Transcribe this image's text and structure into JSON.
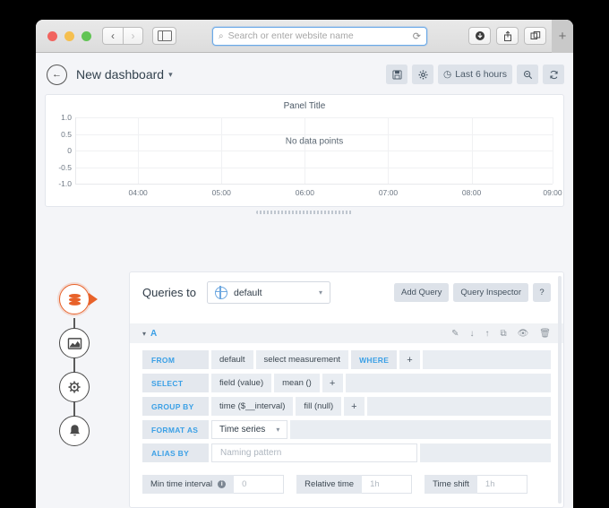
{
  "browser": {
    "traffic_lights": [
      "close",
      "minimize",
      "maximize"
    ],
    "back_label": "‹",
    "forward_label": "›",
    "sidebar_toggle": "sidebar-icon",
    "address_placeholder": "Search or enter website name",
    "search_icon": "⌕",
    "reload_icon": "⟳",
    "download_icon": "⬇",
    "share_icon": "⬆",
    "tabs_icon": "⧉",
    "new_tab_label": "+"
  },
  "dashboard": {
    "back_arrow": "←",
    "title": "New dashboard",
    "title_caret": "▾",
    "toolbar": {
      "save_icon": "⌷",
      "settings_icon": "✸",
      "time_clock_icon": "◷",
      "time_range": "Last 6 hours",
      "zoom_out_icon": "⌕",
      "refresh_icon": "⟳"
    }
  },
  "panel": {
    "title": "Panel Title",
    "no_data_text": "No data points"
  },
  "chart_data": {
    "type": "line",
    "title": "Panel Title",
    "series": [],
    "x": [],
    "xlabel": "",
    "ylabel": "",
    "x_tick_labels": [
      "04:00",
      "05:00",
      "06:00",
      "07:00",
      "08:00",
      "09:00"
    ],
    "y_tick_labels": [
      "1.0",
      "0.5",
      "0",
      "-0.5",
      "-1.0"
    ],
    "y_tick_values": [
      1.0,
      0.5,
      0,
      -0.5,
      -1.0
    ],
    "ylim": [
      -1.0,
      1.0
    ],
    "grid": true,
    "legend": "none",
    "annotation": "No data points"
  },
  "rail": {
    "items": [
      {
        "name": "queries",
        "icon": "⛁",
        "active": true
      },
      {
        "name": "visualization",
        "icon": "📈",
        "active": false
      },
      {
        "name": "general-options",
        "icon": "⚙",
        "active": false
      },
      {
        "name": "alert",
        "icon": "🔔",
        "active": false
      }
    ]
  },
  "editor": {
    "heading": "Queries to",
    "datasource": {
      "name": "default",
      "caret": "▾"
    },
    "add_query_label": "Add Query",
    "query_inspector_label": "Query Inspector",
    "help_label": "?",
    "query": {
      "collapse_caret": "▾",
      "letter": "A",
      "actions": [
        {
          "name": "edit",
          "icon": "✎"
        },
        {
          "name": "move-down",
          "icon": "↓"
        },
        {
          "name": "move-up",
          "icon": "↑"
        },
        {
          "name": "duplicate",
          "icon": "⧉"
        },
        {
          "name": "toggle-visibility",
          "icon": "👁"
        },
        {
          "name": "delete",
          "icon": "🗑"
        }
      ],
      "from_label": "FROM",
      "from_policy": "default",
      "from_measurement": "select measurement",
      "where_label": "WHERE",
      "where_plus": "+",
      "select_label": "SELECT",
      "select_field": "field (value)",
      "select_func": "mean ()",
      "select_plus": "+",
      "group_by_label": "GROUP BY",
      "group_by_time": "time ($__interval)",
      "group_by_fill": "fill (null)",
      "group_by_plus": "+",
      "format_as_label": "FORMAT AS",
      "format_as_value": "Time series",
      "format_as_caret": "▾",
      "alias_by_label": "ALIAS BY",
      "alias_by_placeholder": "Naming pattern"
    },
    "options": {
      "min_time_interval_label": "Min time interval",
      "min_time_interval_info": "i",
      "min_time_interval_value": "0",
      "relative_time_label": "Relative time",
      "relative_time_value": "1h",
      "time_shift_label": "Time shift",
      "time_shift_value": "1h"
    }
  },
  "colors": {
    "accent_blue": "#3ba0e6",
    "accent_orange": "#e8622a",
    "app_bg": "#f4f5f8",
    "panel_bg": "#ffffff",
    "segment_bg": "#e4e8ee"
  }
}
